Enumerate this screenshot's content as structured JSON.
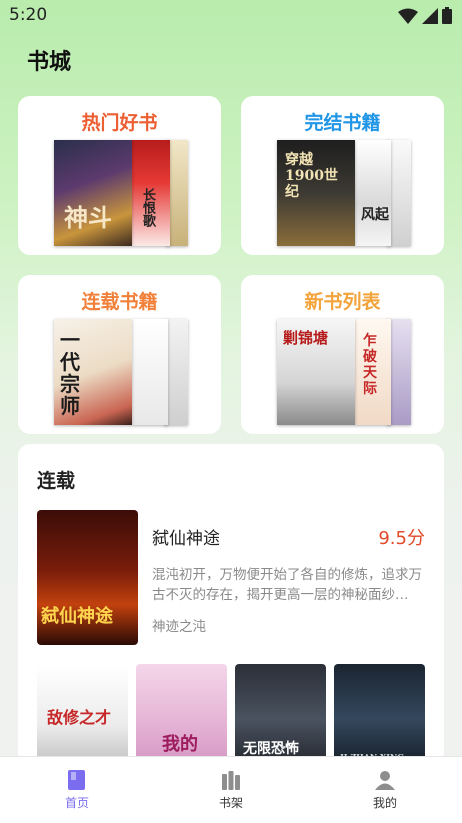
{
  "status": {
    "time": "5:20"
  },
  "page_title": "书城",
  "categories": [
    {
      "label": "热门好书",
      "color": "#ec5f33",
      "covers": [
        "神斗",
        "长恨歌"
      ]
    },
    {
      "label": "完结书籍",
      "color": "#2196e6",
      "covers": [
        "穿越1900世纪",
        "风起"
      ]
    },
    {
      "label": "连载书籍",
      "color": "#f0803a",
      "covers": [
        "一代宗师",
        ""
      ]
    },
    {
      "label": "新书列表",
      "color": "#f2a33a",
      "covers": [
        "剿锦塘",
        "乍破天际"
      ]
    }
  ],
  "serial": {
    "heading": "连载",
    "feature": {
      "title": "弑仙神途",
      "score": "9.5分",
      "description": "混沌初开，万物便开始了各自的修炼，追求万古不灭的存在，揭开更高一层的神秘面纱…",
      "author": "神迹之沌",
      "cover_text": "弑仙神途"
    },
    "thumbs": [
      {
        "cover_text": "敌修之才"
      },
      {
        "cover_text": "我的"
      },
      {
        "cover_text": "无限恐怖"
      },
      {
        "cover_text": "JI ZHAN XING QIU"
      }
    ]
  },
  "nav": [
    {
      "label": "首页",
      "icon": "book-icon",
      "active": true
    },
    {
      "label": "书架",
      "icon": "shelf-icon",
      "active": false
    },
    {
      "label": "我的",
      "icon": "person-icon",
      "active": false
    }
  ],
  "colors": {
    "accent": "#7a6df0",
    "score": "#e2492a",
    "page_bg_top": "#b9ecad"
  }
}
